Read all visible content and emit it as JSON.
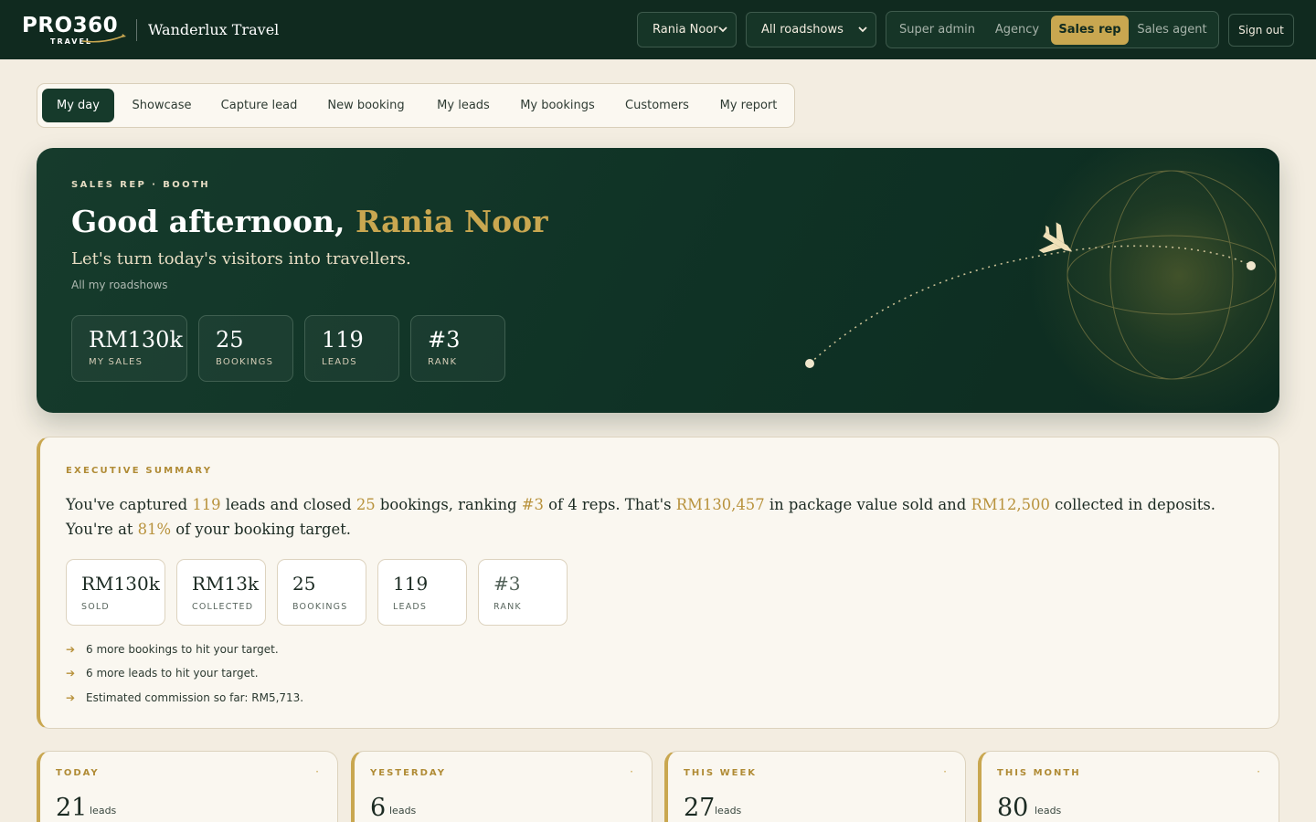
{
  "brand": {
    "logo_text": "PRO360",
    "logo_sub": "TRAVEL",
    "agency": "Wanderlux Travel"
  },
  "header": {
    "user_select": "Rania Noor",
    "roadshow_select": "All roadshows",
    "roles": [
      "Super admin",
      "Agency",
      "Sales rep",
      "Sales agent"
    ],
    "active_role": "Sales rep",
    "signout": "Sign out"
  },
  "nav": {
    "tabs": [
      "My day",
      "Showcase",
      "Capture lead",
      "New booking",
      "My leads",
      "My bookings",
      "Customers",
      "My report"
    ],
    "active": "My day"
  },
  "hero": {
    "eyebrow": "SALES REP · BOOTH",
    "greeting_prefix": "Good afternoon, ",
    "greeting_name": "Rania Noor",
    "tagline": "Let's turn today's visitors into travellers.",
    "scope": "All my roadshows",
    "stats": [
      {
        "value": "RM130k",
        "label": "MY SALES"
      },
      {
        "value": "25",
        "label": "BOOKINGS"
      },
      {
        "value": "119",
        "label": "LEADS"
      },
      {
        "value": "#3",
        "label": "RANK"
      }
    ]
  },
  "summary": {
    "eyebrow": "EXECUTIVE SUMMARY",
    "parts": {
      "p1": "You've captured ",
      "leads": "119",
      "p2": " leads and closed ",
      "bookings": "25",
      "p3": " bookings, ranking ",
      "rank": "#3",
      "p4": " of 4 reps. That's ",
      "sold": "RM130,457",
      "p5": " in package value sold and ",
      "collected": "RM12,500",
      "p6": " collected in deposits. You're at ",
      "target_pct": "81%",
      "p7": " of your booking target."
    },
    "stats": [
      {
        "value": "RM130k",
        "label": "SOLD"
      },
      {
        "value": "RM13k",
        "label": "COLLECTED"
      },
      {
        "value": "25",
        "label": "BOOKINGS"
      },
      {
        "value": "119",
        "label": "LEADS"
      },
      {
        "value": "#3",
        "label": "RANK"
      }
    ],
    "tips": [
      "6 more bookings to hit your target.",
      "6 more leads to hit your target.",
      "Estimated commission so far: RM5,713."
    ]
  },
  "periods": [
    {
      "label": "TODAY",
      "value": "21",
      "unit": "leads"
    },
    {
      "label": "YESTERDAY",
      "value": "6",
      "unit": "leads"
    },
    {
      "label": "THIS WEEK",
      "value": "27",
      "unit": "leads"
    },
    {
      "label": "THIS MONTH",
      "value": "80",
      "unit": "leads"
    }
  ],
  "colors": {
    "primary_dark": "#102a1f",
    "accent_gold": "#c9a750",
    "background": "#f3ede1"
  }
}
